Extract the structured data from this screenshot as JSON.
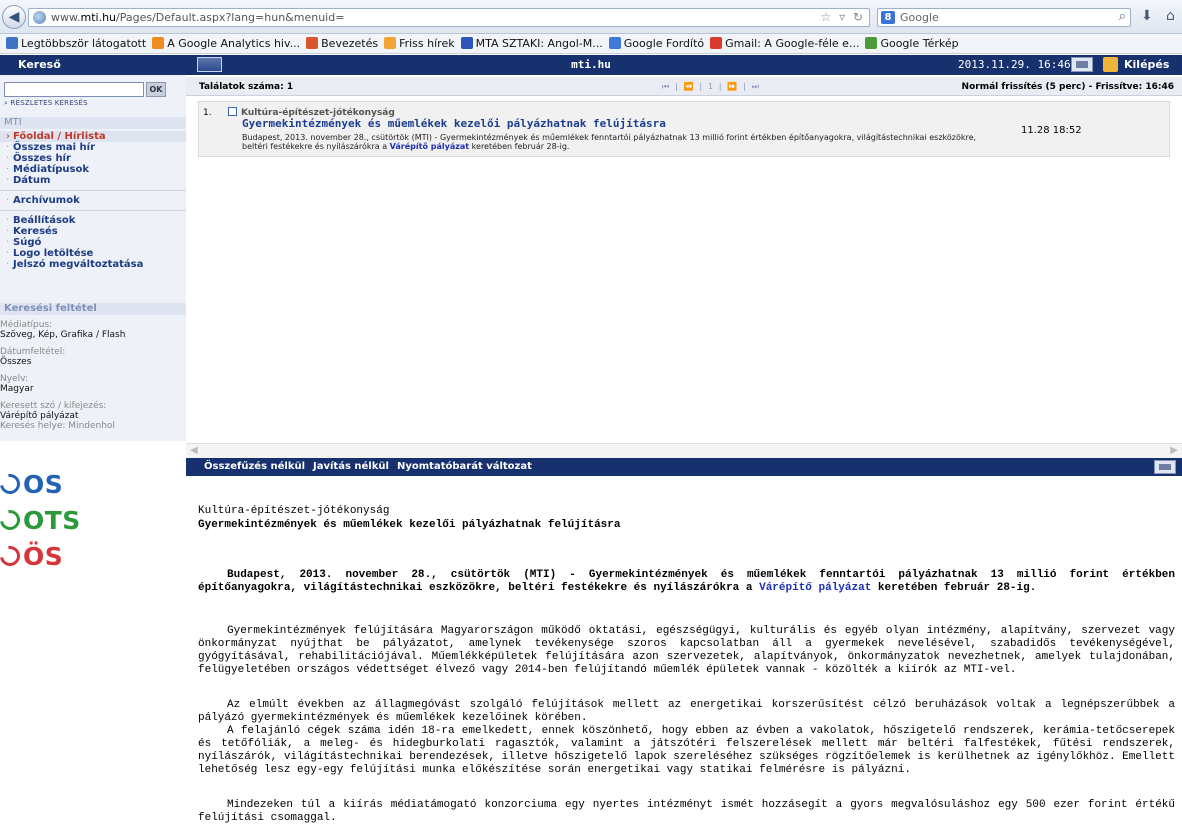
{
  "browser": {
    "url_prefix": "www.",
    "url_domain": "mti.hu",
    "url_rest": "/Pages/Default.aspx?lang=hun&menuid=",
    "search_placeholder": "Google",
    "bookmarks": [
      {
        "label": "Legtöbbször látogatott",
        "color": "#3d74c7"
      },
      {
        "label": "A Google Analytics hiv...",
        "color": "#f08b1d"
      },
      {
        "label": "Bevezetés",
        "color": "#d8572a"
      },
      {
        "label": "Friss hírek",
        "color": "#f2a535"
      },
      {
        "label": "MTA SZTAKI: Angol-M...",
        "color": "#2d55b8"
      },
      {
        "label": "Google Fordító",
        "color": "#3f7ad8"
      },
      {
        "label": "Gmail: A Google-féle e...",
        "color": "#d93a2b"
      },
      {
        "label": "Google Térkép",
        "color": "#4c9b3a"
      }
    ]
  },
  "topbar": {
    "search_title": "Kereső",
    "site": "mti.hu",
    "datetime": "2013.11.29. 16:46",
    "logout": "Kilépés"
  },
  "sidebar": {
    "ok_label": "OK",
    "advanced_search": "RÉSZLETES KERESÉS",
    "mti_heading": "MTI",
    "nav_items": [
      {
        "label": "Főoldal / Hírlista",
        "active": true
      },
      {
        "label": "Összes mai hír",
        "active": false
      },
      {
        "label": "Összes hír",
        "active": false
      },
      {
        "label": "Médiatípusok",
        "active": false
      },
      {
        "label": "Dátum",
        "active": false
      }
    ],
    "archive": "Archívumok",
    "settings_items": [
      "Beállítások",
      "Keresés",
      "Súgó",
      "Logo letöltése",
      "Jelszó megváltoztatása"
    ],
    "filter_heading": "Keresési feltétel",
    "filters": [
      {
        "label": "Médiatípus:",
        "value": "Szöveg, Kép, Grafika / Flash"
      },
      {
        "label": "Dátumfeltétel:",
        "value": "Összes"
      },
      {
        "label": "Nyelv:",
        "value": "Magyar"
      },
      {
        "label": "Keresett szó / kifejezés:",
        "value": "Várépítő pályázat"
      }
    ],
    "search_location": "Keresés helye: Mindenhol"
  },
  "logos": [
    "OS",
    "OTS",
    "ÖS"
  ],
  "results": {
    "count_label": "Találatok száma: 1",
    "pager": "⏮ | ⏪ | 1 | ⏩ | ⏭",
    "refresh": "Normál frissítés (5 perc) - Frissítve: 16:46",
    "items": [
      {
        "num": "1.",
        "category": "Kultúra-építészet-jótékonyság",
        "title": "Gyermekintézmények és műemlékek kezelői pályázhatnak felújításra",
        "body_pre": "Budapest, 2013. november 28., csütörtök (MTI) - Gyermekintézmények és műemlékek fenntartói pályázhatnak 13 millió forint értékben építőanyagokra, világítástechnikai eszközökre, beltéri festékekre és nyílászárókra a ",
        "body_link": "Várépítő pályázat",
        "body_post": " keretében február 28-ig.",
        "time": "11.28 18:52"
      }
    ]
  },
  "article_bar": {
    "buttons": [
      "Összefűzés nélkül",
      "Javítás nélkül",
      "Nyomtatóbarát változat"
    ]
  },
  "article": {
    "category": "Kultúra-építészet-jótékonyság",
    "title": "Gyermekintézmények és műemlékek kezelői pályázhatnak felújításra",
    "lead_pre": "Budapest, 2013. november 28., csütörtök (MTI) - Gyermekintézmények és műemlékek fenntartói pályázhatnak 13 millió forint értékben építőanyagokra, világítástechnikai eszközökre, beltéri festékekre és nyílászárókra a ",
    "lead_link": "Várépítő pályázat",
    "lead_post": " keretében február 28-ig.",
    "paragraphs": [
      "Gyermekintézmények felújítására Magyarországon működő oktatási, egészségügyi, kulturális és egyéb olyan intézmény, alapítvány, szervezet vagy önkormányzat nyújthat be pályázatot, amelynek tevékenysége szoros kapcsolatban áll a gyermekek nevelésével, szabadidős tevékenységével, gyógyításával, rehabilitációjával. Műemlékképületek felújítására azon szervezetek, alapítványok, önkormányzatok nevezhetnek, amelyek tulajdonában, felügyeletében országos védettséget élvező vagy 2014-ben felújítandó műemlék épületek vannak - közölték a kiírók az MTI-vel.",
      "Az elmúlt években az állagmegóvást szolgáló felújítások mellett az energetikai korszerűsítést célzó beruházások voltak a legnépszerűbbek a pályázó gyermekintézmények és műemlékek kezelőinek körében.",
      "A felajánló cégek száma idén 18-ra emelkedett, ennek köszönhető, hogy ebben az évben a vakolatok, hőszigetelő rendszerek, kerámia-tetőcserepek és tetőfóliák, a meleg- és hidegburkolati ragasztók, valamint a játszótéri felszerelések mellett már beltéri falfestékek, fűtési rendszerek, nyílászárók, világítástechnikai berendezések, illetve hőszigetelő lapok szereléséhez szükséges rögzítőelemek is kerülhetnek az igénylőkhöz. Emellett lehetőség lesz egy-egy felújítási munka előkészítése során energetikai vagy statikai felmérésre is pályázni.",
      "Mindezeken túl a kiírás médiatámogató konzorciuma egy nyertes intézményt ismét hozzásegít a gyors megvalósuláshoz egy 500 ezer forint értékű felújítási csomaggal."
    ]
  }
}
